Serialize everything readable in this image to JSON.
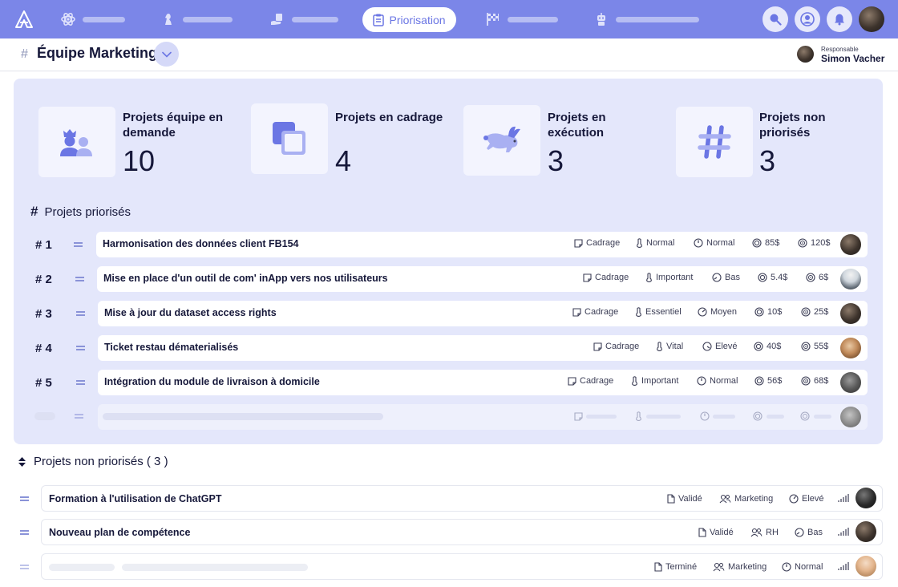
{
  "nav": {
    "active_label": "Priorisation"
  },
  "team": {
    "title": "Équipe Marketing",
    "responsable_label": "Responsable",
    "responsable_name": "Simon Vacher"
  },
  "stats": [
    {
      "title": "Projets équipe en demande",
      "value": "10",
      "icon": "user-group-icon"
    },
    {
      "title": "Projets en cadrage",
      "value": "4",
      "icon": "copy-squares-icon"
    },
    {
      "title": "Projets en exécution",
      "value": "3",
      "icon": "rabbit-icon"
    },
    {
      "title": "Projets non priorisés",
      "value": "3",
      "icon": "hashtag-icon"
    }
  ],
  "prioritized": {
    "title": "Projets priorisés",
    "rows": [
      {
        "rank": "# 1",
        "name": "Harmonisation des données client FB154",
        "status": "Cadrage",
        "urgency": "Normal",
        "impact": "Normal",
        "cost": "85$",
        "value": "120$"
      },
      {
        "rank": "# 2",
        "name": "Mise en place d'un outil de com' inApp vers nos utilisateurs",
        "status": "Cadrage",
        "urgency": "Important",
        "impact": "Bas",
        "cost": "5.4$",
        "value": "6$"
      },
      {
        "rank": "# 3",
        "name": "Mise à jour du dataset access rights",
        "status": "Cadrage",
        "urgency": "Essentiel",
        "impact": "Moyen",
        "cost": "10$",
        "value": "25$"
      },
      {
        "rank": "# 4",
        "name": "Ticket restau dématerialisés",
        "status": "Cadrage",
        "urgency": "Vital",
        "impact": "Elevé",
        "cost": "40$",
        "value": "55$"
      },
      {
        "rank": "# 5",
        "name": "Intégration du module de livraison à domicile",
        "status": "Cadrage",
        "urgency": "Important",
        "impact": "Normal",
        "cost": "56$",
        "value": "68$"
      }
    ]
  },
  "non_prioritized": {
    "title": "Projets non priorisés ( 3 )",
    "rows": [
      {
        "name": "Formation à l'utilisation de ChatGPT",
        "status": "Validé",
        "team": "Marketing",
        "impact": "Elevé"
      },
      {
        "name": "Nouveau plan de compétence",
        "status": "Validé",
        "team": "RH",
        "impact": "Bas"
      },
      {
        "name": "",
        "status": "Terminé",
        "team": "Marketing",
        "impact": "Normal"
      }
    ]
  },
  "colors": {
    "nav_bg": "#7b86e8",
    "panel_bg": "#e4e7fb",
    "accent": "#6b76e4"
  }
}
